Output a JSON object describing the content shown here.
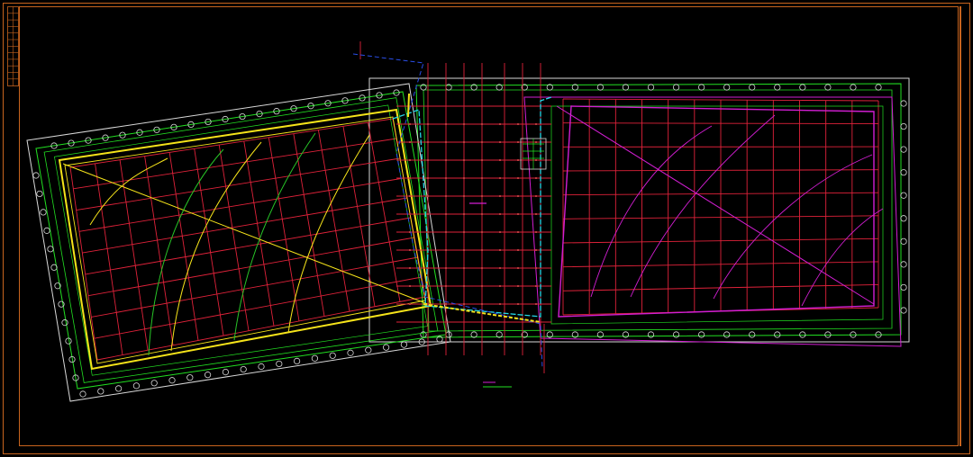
{
  "drawing": {
    "colors": {
      "background": "#000000",
      "frame": "#c8641e",
      "grid": "#e0223a",
      "axis_green": "#22e022",
      "border_white": "#d8d8d8",
      "slab_yellow": "#f5e31a",
      "curve_green": "#28c828",
      "magenta": "#d21ed2",
      "cyan": "#22d8e8",
      "blue": "#2a4ee8"
    },
    "description_text": []
  }
}
